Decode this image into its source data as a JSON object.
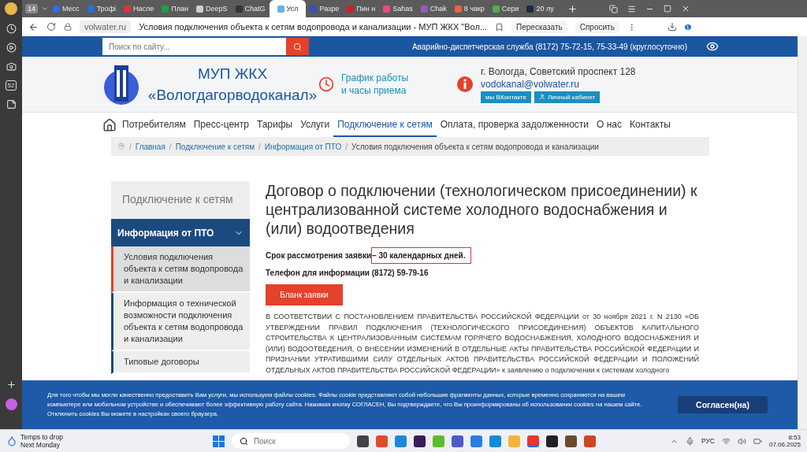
{
  "browser": {
    "tab_count": "14",
    "tabs": [
      {
        "label": "Месс",
        "color": "#2f6fe0",
        "selected": false
      },
      {
        "label": "Трофі",
        "color": "#2a6fd6",
        "selected": false
      },
      {
        "label": "Насле",
        "color": "#e0323c",
        "selected": false
      },
      {
        "label": "План",
        "color": "#1f9d4c",
        "selected": false
      },
      {
        "label": "DeepS",
        "color": "#cfcfcf",
        "selected": false
      },
      {
        "label": "ChatG",
        "color": "#333333",
        "selected": false
      },
      {
        "label": "Усл",
        "color": "#6ab0e8",
        "selected": true
      },
      {
        "label": "Разре",
        "color": "#3a4fc0",
        "selected": false
      },
      {
        "label": "Пин н",
        "color": "#d0202a",
        "selected": false
      },
      {
        "label": "Sahas",
        "color": "#e84a8a",
        "selected": false
      },
      {
        "label": "Chak",
        "color": "#9b59b6",
        "selected": false
      },
      {
        "label": "8 чакр",
        "color": "#e8643a",
        "selected": false
      },
      {
        "label": "Сери",
        "color": "#4caf50",
        "selected": false
      },
      {
        "label": "20 лу",
        "color": "#1c2a48",
        "selected": false
      }
    ],
    "domain": "volwater.ru",
    "page_title": "Условия подключения объекта к сетям водопровода и канализации - МУП ЖКХ \"Вол...",
    "actions": [
      "Пересказать",
      "Спросить"
    ],
    "side_badge": "52",
    "downloads_badge": "1"
  },
  "site": {
    "search": {
      "placeholder": "Поиск по сайту..."
    },
    "emergency": "Аварийно-диспетчерская служба (8172) 75-72-15, 75-33-49 (круглосуточно)",
    "org": [
      "МУП ЖКХ",
      "«Вологдагорводоканал»"
    ],
    "schedule": [
      "График работы",
      "и часы приема"
    ],
    "address": "г. Вологда, Советский проспект 128",
    "email": "vodokanal@volwater.ru",
    "social_buttons": [
      "мы ВКонтакте",
      "Личный кабинет"
    ],
    "nav": [
      {
        "label": "Потребителям",
        "selected": false
      },
      {
        "label": "Пресс-центр",
        "selected": false
      },
      {
        "label": "Тарифы",
        "selected": false
      },
      {
        "label": "Услуги",
        "selected": false
      },
      {
        "label": "Подключение к сетям",
        "selected": true
      },
      {
        "label": "Оплата, проверка задолженности",
        "selected": false
      },
      {
        "label": "О нас",
        "selected": false
      },
      {
        "label": "Контакты",
        "selected": false
      }
    ],
    "breadcrumbs": [
      {
        "separator": "/",
        "label": "Главная"
      },
      {
        "separator": "/",
        "label": "Подключение к сетям"
      },
      {
        "separator": "/",
        "label": "Информация от ПТО"
      }
    ],
    "breadcrumb_current": {
      "separator": "/",
      "label": "Условия подключения объекта к сетям водопровода и канализации"
    },
    "sidebar": {
      "title": "Подключение к сетям",
      "group": {
        "label": "Информация от ПТО",
        "expanded": true
      },
      "items": [
        {
          "label": "Условия подключения объекта к сетям водопровода и канализации",
          "selected": true
        },
        {
          "label": "Информация о технической возможности подключения объекта к сетям водопровода и канализации",
          "selected": false
        },
        {
          "label": "Типовые договоры",
          "selected": false
        }
      ]
    },
    "article": {
      "title": "Договор о подключении (технологическом присоединении) к централизованной системе холодного водоснабжения и (или) водоотведения",
      "term_label": "Срок рассмотрения заявки ",
      "term_value": "– 30 календарных дней.",
      "phone": "Телефон для информации (8172) 59-79-16",
      "button": "Бланк заявки",
      "paragraph": "В СООТВЕТСТВИИ С ПОСТАНОВЛЕНИЕМ ПРАВИТЕЛЬСТВА РОССИЙСКОЙ ФЕДЕРАЦИИ от 30 ноября 2021 г. N 2130 «ОБ УТВЕРЖДЕНИИ ПРАВИЛ ПОДКЛЮЧЕНИЯ (ТЕХНОЛОГИЧЕСКОГО ПРИСОЕДИНЕНИЯ) ОБЪЕКТОВ КАПИТАЛЬНОГО СТРОИТЕЛЬСТВА К ЦЕНТРАЛИЗОВАННЫМ СИСТЕМАМ ГОРЯЧЕГО ВОДОСНАБЖЕНИЯ, ХОЛОДНОГО ВОДОСНАБЖЕНИЯ И (ИЛИ) ВОДООТВЕДЕНИЯ, О ВНЕСЕНИИ ИЗМЕНЕНИЙ В ОТДЕЛЬНЫЕ АКТЫ ПРАВИТЕЛЬСТВА РОССИЙСКОЙ ФЕДЕРАЦИИ И ПРИЗНАНИИ УТРАТИВШИМИ СИЛУ ОТДЕЛЬНЫХ АКТОВ ПРАВИТЕЛЬСТВА РОССИЙСКОЙ ФЕДЕРАЦИИ И ПОЛОЖЕНИЙ ОТДЕЛЬНЫХ АКТОВ ПРАВИТЕЛЬСТВА РОССИЙСКОЙ ФЕДЕРАЦИИ» к заявлению о подключении к системам холодного"
    },
    "cookie": {
      "text": "Для того чтобы мы могли качественно предоставить Вам услуги, мы используем файлы cookies. Файлы cookie представляют собой небольшие фрагменты данных, которые временно сохраняются на вашем компьютере или мобильном устройстве и обеспечивают более эффективную работу сайта. Нажимая кнопку СОГЛАСЕН, Вы подтверждаете, что Вы проинформированы об использовании cookies на нашем сайте. Отключить cookies Вы можете в настройках своего браузера.",
      "button": "Согласен(на)"
    }
  },
  "taskbar": {
    "weather": [
      "Temps to drop",
      "Next Monday"
    ],
    "search": {
      "placeholder": "Поиск"
    },
    "apps": [
      {
        "color": "#444444",
        "selected": false
      },
      {
        "color": "#e24a2b",
        "selected": false
      },
      {
        "color": "#1e88d6",
        "selected": false
      },
      {
        "color": "#3a1e5c",
        "selected": false
      },
      {
        "color": "#5bbd2b",
        "selected": false
      },
      {
        "color": "#5059c9",
        "selected": false
      },
      {
        "color": "#2a7de1",
        "selected": false
      },
      {
        "color": "#0f8cd8",
        "selected": false
      },
      {
        "color": "#f2b33d",
        "selected": false
      },
      {
        "color": "#e8362e",
        "selected": true
      },
      {
        "color": "#222222",
        "selected": false
      },
      {
        "color": "#6b4a2b",
        "selected": false
      },
      {
        "color": "#d04423",
        "selected": false
      }
    ],
    "language": "РУС",
    "time": "8:53",
    "date": "07.06.2025"
  }
}
